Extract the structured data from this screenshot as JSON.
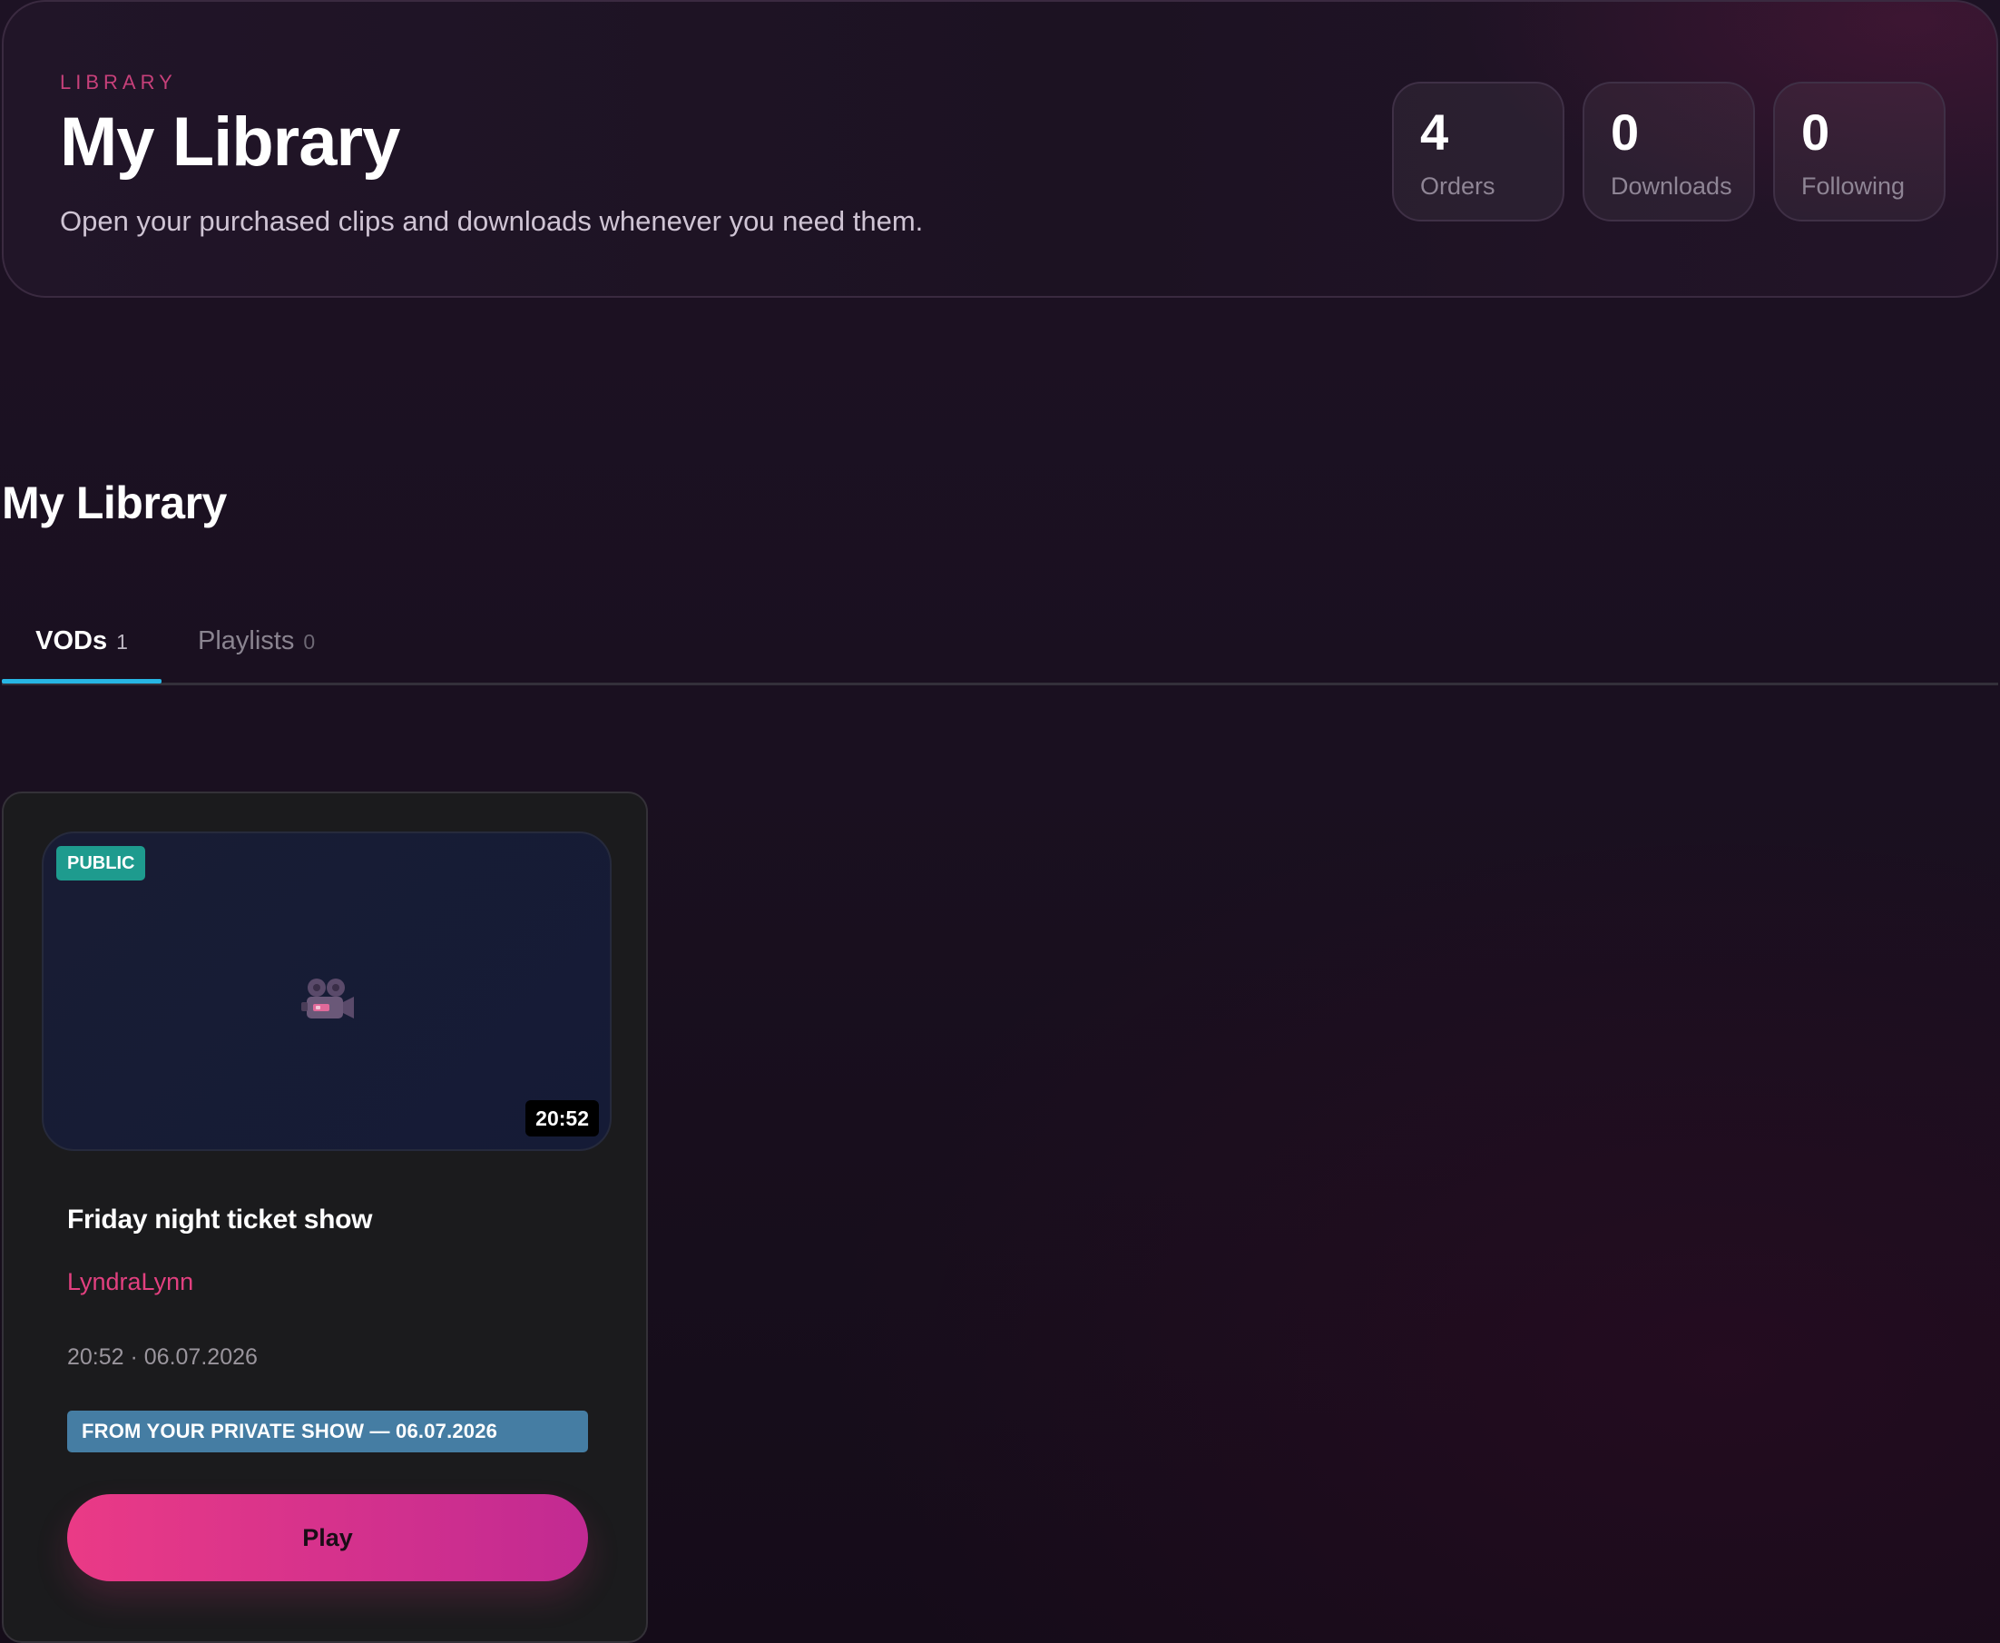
{
  "hero": {
    "eyebrow": "LIBRARY",
    "title": "My Library",
    "subtitle": "Open your purchased clips and downloads whenever you need them.",
    "stats": [
      {
        "value": "4",
        "label": "Orders"
      },
      {
        "value": "0",
        "label": "Downloads"
      },
      {
        "value": "0",
        "label": "Following"
      }
    ]
  },
  "section": {
    "title": "My Library"
  },
  "tabs": [
    {
      "label": "VODs",
      "count": "1",
      "active": true
    },
    {
      "label": "Playlists",
      "count": "0",
      "active": false
    }
  ],
  "vods": [
    {
      "visibility": "PUBLIC",
      "thumbnail_icon": "movie-camera-icon",
      "duration": "20:52",
      "title": "Friday night ticket show",
      "creator": "LyndraLynn",
      "meta": "20:52 · 06.07.2026",
      "banner": "FROM YOUR PRIVATE SHOW — 06.07.2026",
      "play_label": "Play"
    }
  ],
  "colors": {
    "accent_pink": "#e2407f",
    "active_tab_underline": "#27b6e4",
    "public_badge": "#1e9b8e",
    "private_banner": "#457da3",
    "play_gradient_start": "#ea3a86",
    "play_gradient_end": "#c22a92"
  }
}
